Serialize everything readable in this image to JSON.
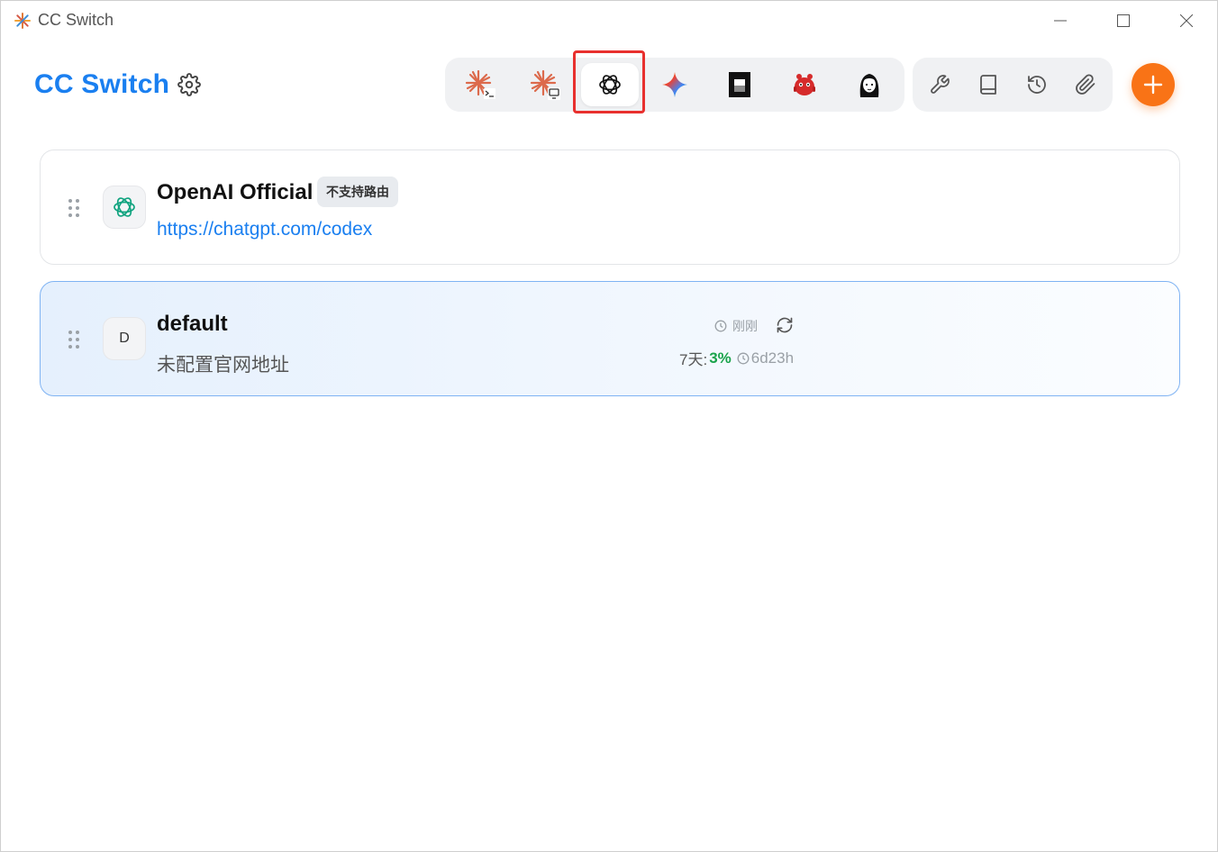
{
  "window": {
    "title": "CC Switch"
  },
  "header": {
    "brand": "CC Switch",
    "settings_icon": "gear-icon",
    "apps": [
      {
        "id": "claude-code",
        "icon": "claude-terminal-icon",
        "active": false
      },
      {
        "id": "claude-desktop",
        "icon": "claude-desktop-icon",
        "active": false
      },
      {
        "id": "codex",
        "icon": "openai-icon",
        "active": true
      },
      {
        "id": "gemini",
        "icon": "gemini-sparkle-icon",
        "active": false
      },
      {
        "id": "app-5",
        "icon": "dark-square-icon",
        "active": false
      },
      {
        "id": "app-6",
        "icon": "red-creature-icon",
        "active": false
      },
      {
        "id": "app-7",
        "icon": "portrait-icon",
        "active": false
      }
    ],
    "tools": [
      {
        "id": "wrench",
        "icon": "wrench-icon"
      },
      {
        "id": "book",
        "icon": "book-icon"
      },
      {
        "id": "history",
        "icon": "history-icon"
      },
      {
        "id": "attach",
        "icon": "paperclip-icon"
      }
    ],
    "add_icon": "plus-icon"
  },
  "providers": [
    {
      "name": "OpenAI Official",
      "badge": "不支持路由",
      "url": "https://chatgpt.com/codex",
      "icon": "openai-icon"
    },
    {
      "name": "default",
      "avatar_letter": "D",
      "subtitle": "未配置官网地址",
      "usage": {
        "updated": "刚刚",
        "period": "7天:",
        "percent": "3%",
        "reset": "6d23h"
      }
    }
  ],
  "colors": {
    "brand": "#1a7ff0",
    "accent": "#f97316",
    "highlight": "#e8302e",
    "usage_good": "#18a34a"
  }
}
